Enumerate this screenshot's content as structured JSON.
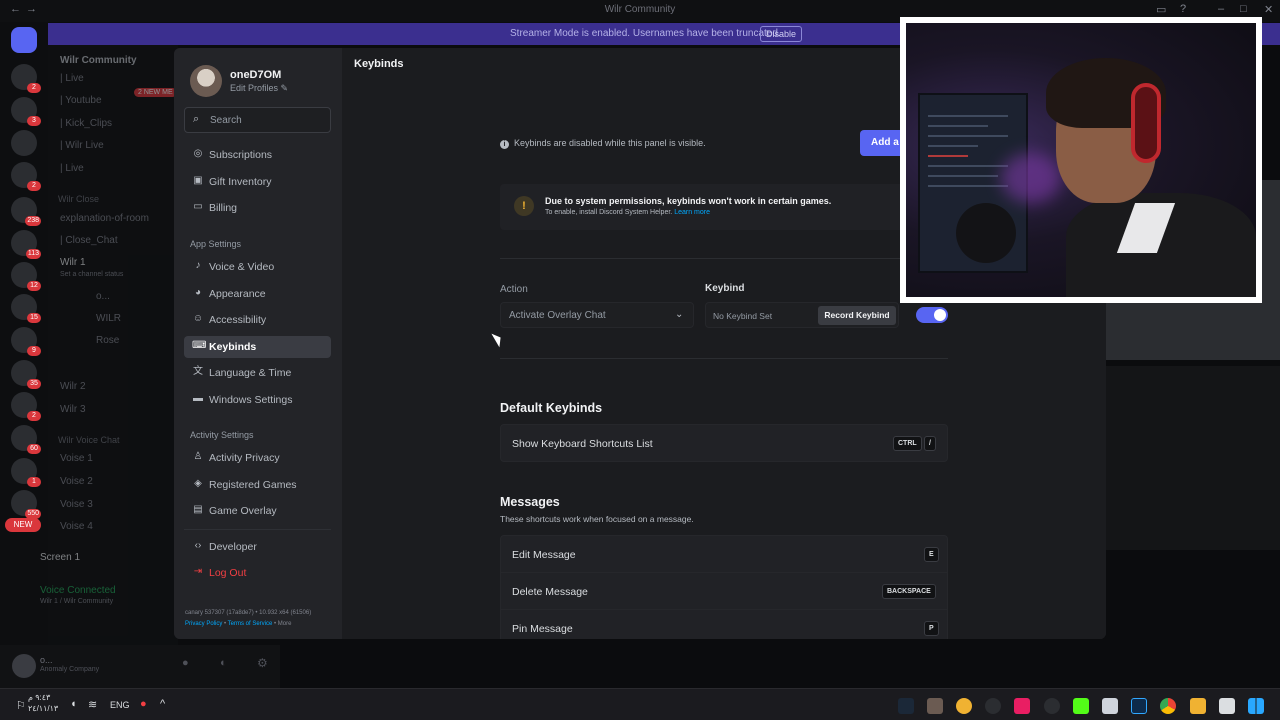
{
  "window": {
    "title": "Wilr Community"
  },
  "banner": {
    "text": "Streamer Mode is enabled. Usernames have been truncated.",
    "button": "Disable"
  },
  "server_rail": {
    "badges": [
      "2",
      "3",
      "2",
      "238",
      "113",
      "12",
      "15",
      "9",
      "35",
      "2",
      "60",
      "1",
      "550"
    ],
    "new_label": "NEW"
  },
  "channels": {
    "server_name": "Wilr Community",
    "new_mentions": "2 NEW ME",
    "items": [
      "| Live",
      "| Youtube",
      "| Kick_Clips",
      "| Wilr Live",
      "| Live",
      "explanation-of-room",
      "| Close_Chat",
      "Wilr 1",
      "Wilr 2",
      "Wilr 3",
      "Voise 1",
      "Voise 2",
      "Voise 3",
      "Voise 4"
    ],
    "categories": [
      "Wilr Close",
      "Wilr Voice Chat"
    ],
    "voice_users": [
      "o...",
      "WILR",
      "Rose"
    ],
    "voice_status": "Set a channel status",
    "screen": "Screen 1",
    "voice_connected": "Voice Connected",
    "voice_path": "Wilr 1 / Wilr Community"
  },
  "userbar": {
    "name": "o...",
    "status": "Anomaly Company"
  },
  "profile": {
    "username": "oneD7OM",
    "edit": "Edit Profiles"
  },
  "search": {
    "placeholder": "Search"
  },
  "nav": {
    "user_items": [
      "Subscriptions",
      "Gift Inventory",
      "Billing"
    ],
    "app_section": "App Settings",
    "app_items": [
      "Voice & Video",
      "Appearance",
      "Accessibility",
      "Keybinds",
      "Language & Time",
      "Windows Settings"
    ],
    "activity_section": "Activity Settings",
    "activity_items": [
      "Activity Privacy",
      "Registered Games",
      "Game Overlay"
    ],
    "developer": "Developer",
    "logout": "Log Out"
  },
  "footer": {
    "build": "canary 537307 (17a8de7) • 10.932 x64 (61506)",
    "privacy": "Privacy Policy",
    "terms": "Terms of Service",
    "more": "More"
  },
  "keybinds": {
    "header": "Keybinds",
    "disabled_note": "Keybinds are disabled while this panel is visible.",
    "add_button": "Add a",
    "warning_title": "Due to system permissions, keybinds won't work in certain games.",
    "warning_sub": "To enable, install Discord System Helper.",
    "warning_link": "Learn more",
    "action_label": "Action",
    "keybind_label": "Keybind",
    "action_value": "Activate Overlay Chat",
    "keybind_value": "No Keybind Set",
    "record_button": "Record Keybind",
    "toggle_on": true,
    "default_title": "Default Keybinds",
    "default_rows": [
      {
        "name": "Show Keyboard Shortcuts List",
        "keys": [
          "CTRL",
          "/"
        ]
      }
    ],
    "messages_title": "Messages",
    "messages_sub": "These shortcuts work when focused on a message.",
    "message_rows": [
      {
        "name": "Edit Message",
        "keys": [
          "E"
        ]
      },
      {
        "name": "Delete Message",
        "keys": [
          "BACKSPACE"
        ]
      },
      {
        "name": "Pin Message",
        "keys": [
          "P"
        ]
      }
    ]
  },
  "taskbar": {
    "lang": "ENG",
    "clock_time": "٩:٤٣ م",
    "clock_date": "٢٤/١١/١٣"
  },
  "colors": {
    "accent": "#5865f2",
    "danger": "#f23f43",
    "banner": "#3b2f8f",
    "warning": "#f0b232"
  }
}
